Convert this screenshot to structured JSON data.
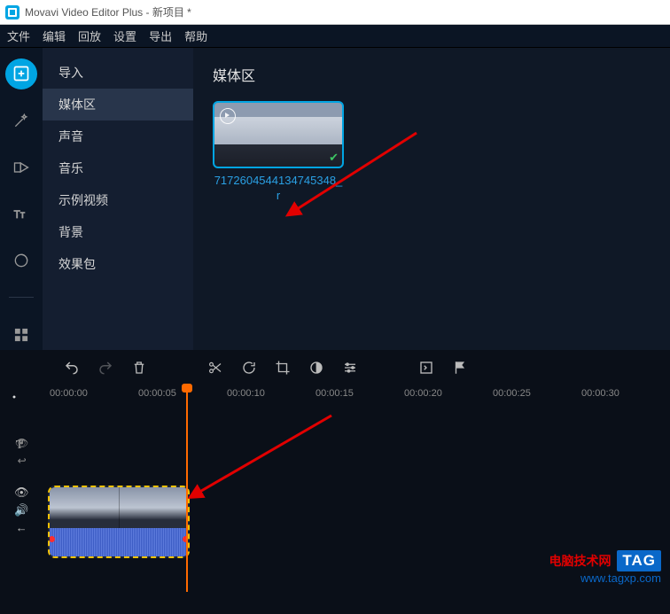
{
  "window": {
    "title": "Movavi Video Editor Plus - 新项目 *"
  },
  "menu": [
    "文件",
    "编辑",
    "回放",
    "设置",
    "导出",
    "帮助"
  ],
  "rail": {
    "items": [
      {
        "name": "add-media-icon",
        "active": true
      },
      {
        "name": "filters-icon"
      },
      {
        "name": "transitions-icon"
      },
      {
        "name": "titles-icon"
      },
      {
        "name": "stickers-icon"
      },
      {
        "name": "more-tools-icon"
      }
    ]
  },
  "sidebar": {
    "items": [
      {
        "label": "导入"
      },
      {
        "label": "媒体区",
        "selected": true
      },
      {
        "label": "声音"
      },
      {
        "label": "音乐"
      },
      {
        "label": "示例视频"
      },
      {
        "label": "背景"
      },
      {
        "label": "效果包"
      }
    ]
  },
  "content": {
    "heading": "媒体区",
    "clip_name": "7172604544134745348_r"
  },
  "timeline": {
    "times": [
      "00:00:00",
      "00:00:05",
      "00:00:10",
      "00:00:15",
      "00:00:20",
      "00:00:25",
      "00:00:30"
    ]
  },
  "watermark": {
    "cn": "电脑技术网",
    "tag": "TAG",
    "url": "www.tagxp.com"
  }
}
